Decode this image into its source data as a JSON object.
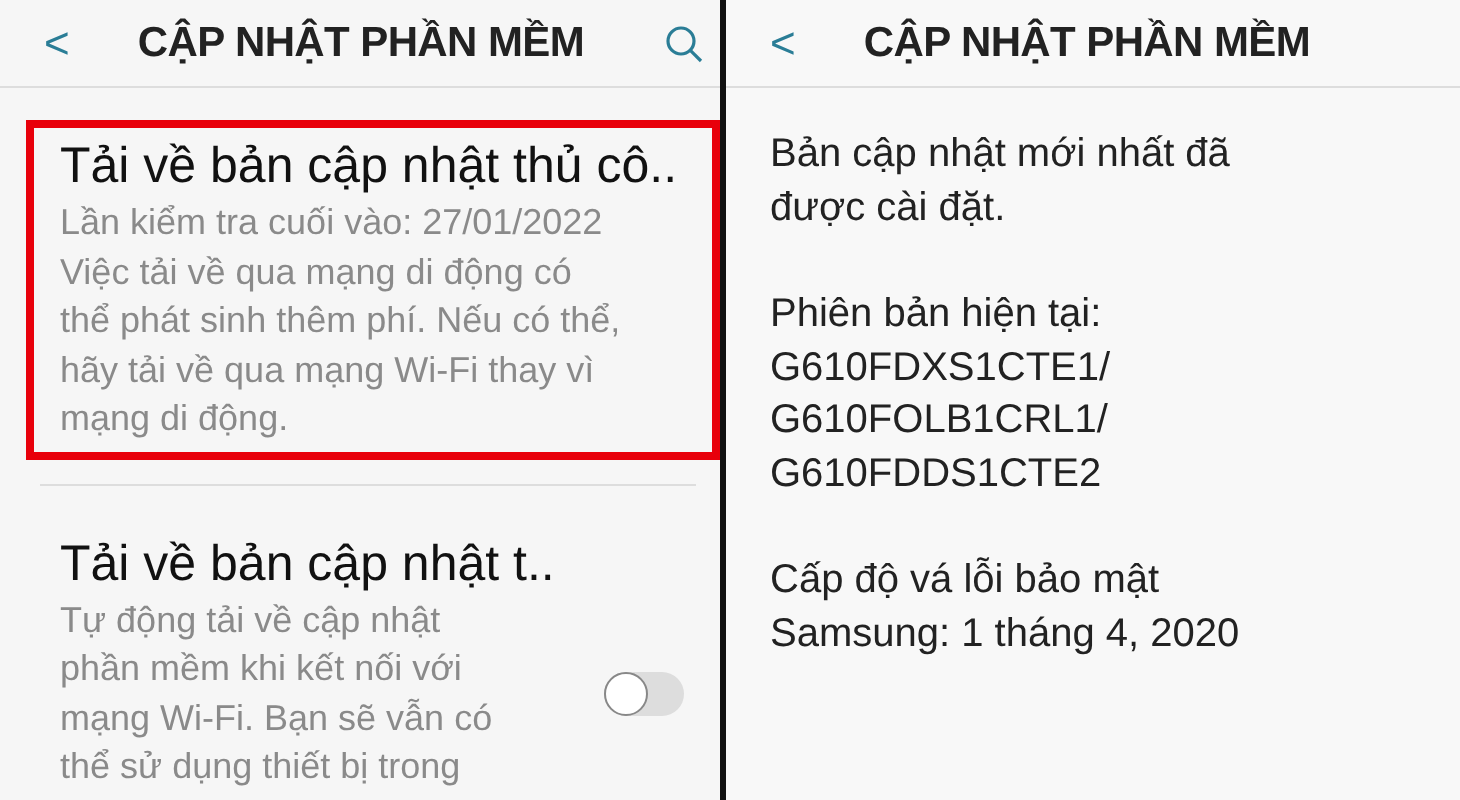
{
  "left_screen": {
    "header": {
      "back": "<",
      "title": "CẬP NHẬT PHẦN MỀM",
      "search": true
    },
    "items": [
      {
        "title": "Tải về bản cập nhật thủ cô..",
        "description_lines": [
          "Lần kiểm tra cuối vào: 27/01/2022",
          "Việc tải về qua mạng di động có",
          "thể phát sinh thêm phí. Nếu có thể,",
          "hãy tải về qua mạng Wi-Fi thay vì",
          "mạng di động."
        ],
        "highlighted": true,
        "kind": "plain"
      },
      {
        "title": "Tải về bản cập nhật t..",
        "description_lines": [
          "Tự động tải về cập nhật",
          "phần mềm khi kết nối với",
          "mạng Wi-Fi. Bạn sẽ vẫn có",
          "thể sử dụng thiết bị trong"
        ],
        "highlighted": false,
        "kind": "switch",
        "on": false
      }
    ]
  },
  "right_screen": {
    "header": {
      "back": "<",
      "title": "CẬP NHẬT PHẦN MỀM"
    },
    "paragraphs": [
      [
        "Bản cập nhật mới nhất đã",
        "được cài đặt."
      ],
      [
        "Phiên bản hiện tại:",
        "G610FDXS1CTE1/",
        "G610FOLB1CRL1/",
        "G610FDDS1CTE2"
      ],
      [
        "Cấp độ vá lỗi bảo mật",
        "Samsung: 1 tháng 4, 2020"
      ]
    ]
  }
}
